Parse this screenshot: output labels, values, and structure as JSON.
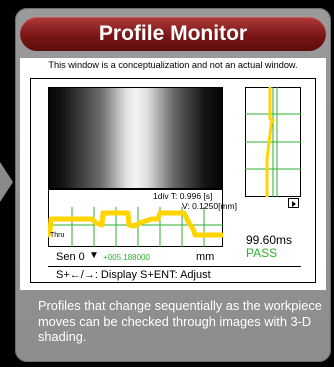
{
  "header": {
    "title": "Profile Monitor"
  },
  "notice": "This window is a conceptualization and not an actual window.",
  "graph": {
    "division_time": "1div T: 0.996 [s]",
    "division_v": "V: 0.1250[mm]",
    "thru_label": "Thru"
  },
  "sensor": {
    "label": "Sen 0",
    "value": "+005.188000",
    "unit": "mm"
  },
  "result": {
    "time": "99.60ms",
    "status": "PASS"
  },
  "instruction": "S+←/→: Display S+ENT: Adjust",
  "description": "Profiles that change sequentially as the workpiece moves can be checked through images with 3-D shading.",
  "colors": {
    "title_bar": "#7a1616",
    "profile_line": "#ffd400",
    "grid_line": "#2fb032",
    "pass": "#2fb032",
    "value": "#2fb032"
  }
}
